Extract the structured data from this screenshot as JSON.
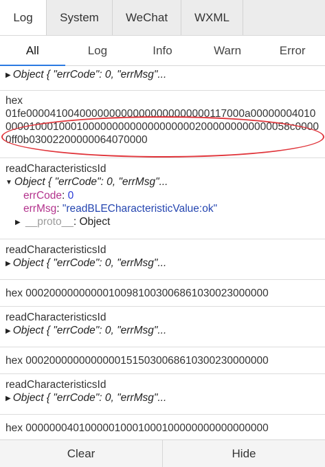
{
  "tabs": [
    "Log",
    "System",
    "WeChat",
    "WXML"
  ],
  "filters": [
    "All",
    "Log",
    "Info",
    "Warn",
    "Error"
  ],
  "entries": {
    "e0": {
      "obj": "Object { \"errCode\": 0, \"errMsg\"..."
    },
    "e1": {
      "label": "hex",
      "hex": "01fe0000410040000000000000000000000117000a00000004010000010001000100000000000000000002000000000000058c00000ff0b03002200000064070000"
    },
    "e2": {
      "label": "readCharacteristicsId",
      "obj": "Object { \"errCode\": 0, \"errMsg\"...",
      "errCode_key": "errCode",
      "errCode_val": "0",
      "errMsg_key": "errMsg",
      "errMsg_val": "\"readBLECharacteristicValue:ok\"",
      "proto_key": "__proto__",
      "proto_val": "Object"
    },
    "e3": {
      "label": "readCharacteristicsId",
      "obj": "Object { \"errCode\": 0, \"errMsg\"..."
    },
    "e4": {
      "text": "hex 00020000000000100981003006861030023000000"
    },
    "e5": {
      "label": "readCharacteristicsId",
      "obj": "Object { \"errCode\": 0, \"errMsg\"..."
    },
    "e6": {
      "text": "hex 00020000000000001515030068610300230000000"
    },
    "e7": {
      "label": "readCharacteristicsId",
      "obj": "Object { \"errCode\": 0, \"errMsg\"..."
    },
    "e8": {
      "text": "hex 00000004010000010001000100000000000000000"
    }
  },
  "bottom": {
    "clear": "Clear",
    "hide": "Hide"
  },
  "colors": {
    "highlight_oval": "#e0343a",
    "active_filter_underline": "#2a7ae2"
  }
}
